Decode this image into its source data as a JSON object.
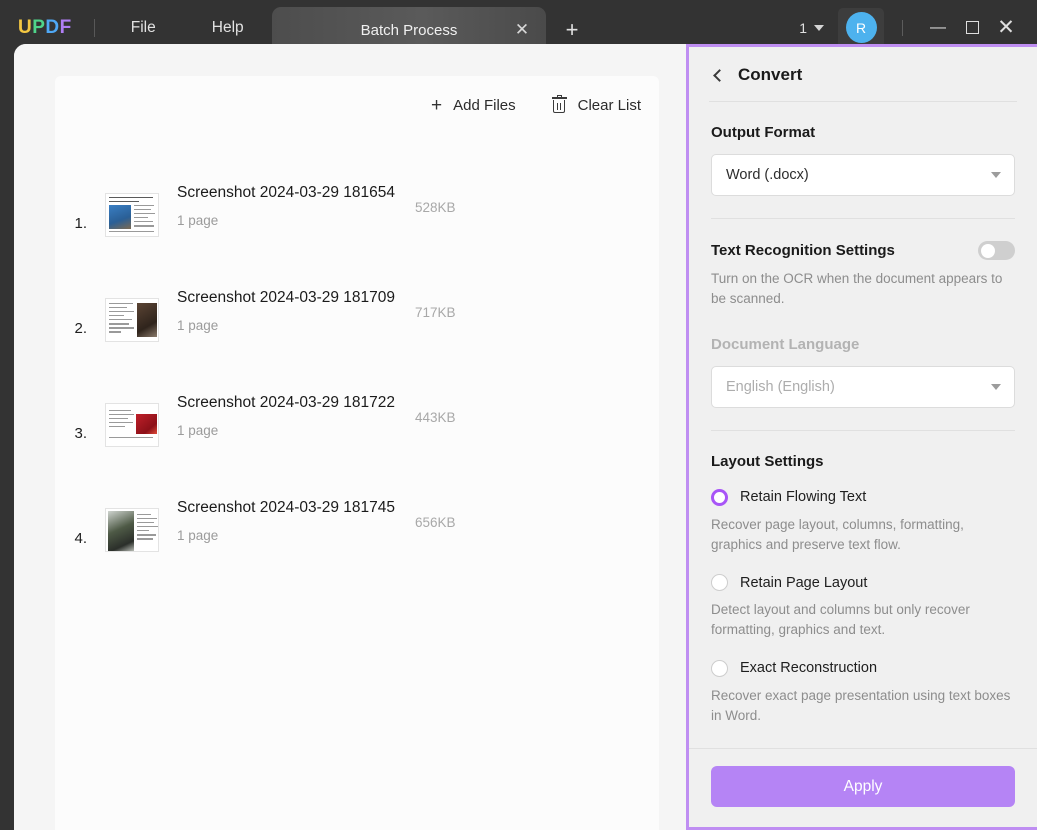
{
  "window": {
    "logo": {
      "u": "U",
      "p": "P",
      "d": "D",
      "f": "F"
    },
    "menus": [
      {
        "label": "File"
      },
      {
        "label": "Help"
      }
    ],
    "tab": {
      "label": "Batch Process",
      "close_icon": "close-icon"
    },
    "new_tab_icon": "plus-icon",
    "page_count": "1",
    "avatar_initial": "R",
    "controls": {
      "minimize": "minimize-icon",
      "maximize": "maximize-icon",
      "close": "close-icon"
    }
  },
  "file_pane": {
    "toolbar": {
      "add_files_label": "Add Files",
      "add_files_icon": "plus-icon",
      "clear_list_label": "Clear List",
      "clear_list_icon": "trash-icon"
    },
    "files": [
      {
        "index": "1.",
        "name": "Screenshot 2024-03-29 181654",
        "pages": "1 page",
        "size": "528KB",
        "thumb": "cat-photo-left"
      },
      {
        "index": "2.",
        "name": "Screenshot 2024-03-29 181709",
        "pages": "1 page",
        "size": "717KB",
        "thumb": "photo-right-dark"
      },
      {
        "index": "3.",
        "name": "Screenshot 2024-03-29 181722",
        "pages": "1 page",
        "size": "443KB",
        "thumb": "photo-right-red"
      },
      {
        "index": "4.",
        "name": "Screenshot 2024-03-29 181745",
        "pages": "1 page",
        "size": "656KB",
        "thumb": "photo-left-green"
      }
    ]
  },
  "convert_panel": {
    "back_icon": "chevron-left-icon",
    "title": "Convert",
    "output_format": {
      "label": "Output Format",
      "value": "Word (.docx)"
    },
    "text_recognition": {
      "label": "Text Recognition Settings",
      "enabled": false,
      "hint": "Turn on the OCR when the document appears to be scanned.",
      "language_label": "Document Language",
      "language_value": "English (English)"
    },
    "layout_settings": {
      "label": "Layout Settings",
      "options": [
        {
          "label": "Retain Flowing Text",
          "selected": true,
          "description": "Recover page layout, columns, formatting, graphics and preserve text flow."
        },
        {
          "label": "Retain Page Layout",
          "selected": false,
          "description": "Detect layout and columns but only recover formatting, graphics and text."
        },
        {
          "label": "Exact Reconstruction",
          "selected": false,
          "description": "Recover exact page presentation using text boxes in Word."
        }
      ]
    },
    "apply_label": "Apply"
  },
  "colors": {
    "accent_purple": "#a855f7",
    "apply_button": "#b584f5",
    "panel_border": "#bf8ef2",
    "titlebar": "#333333",
    "avatar": "#4db2ee"
  }
}
